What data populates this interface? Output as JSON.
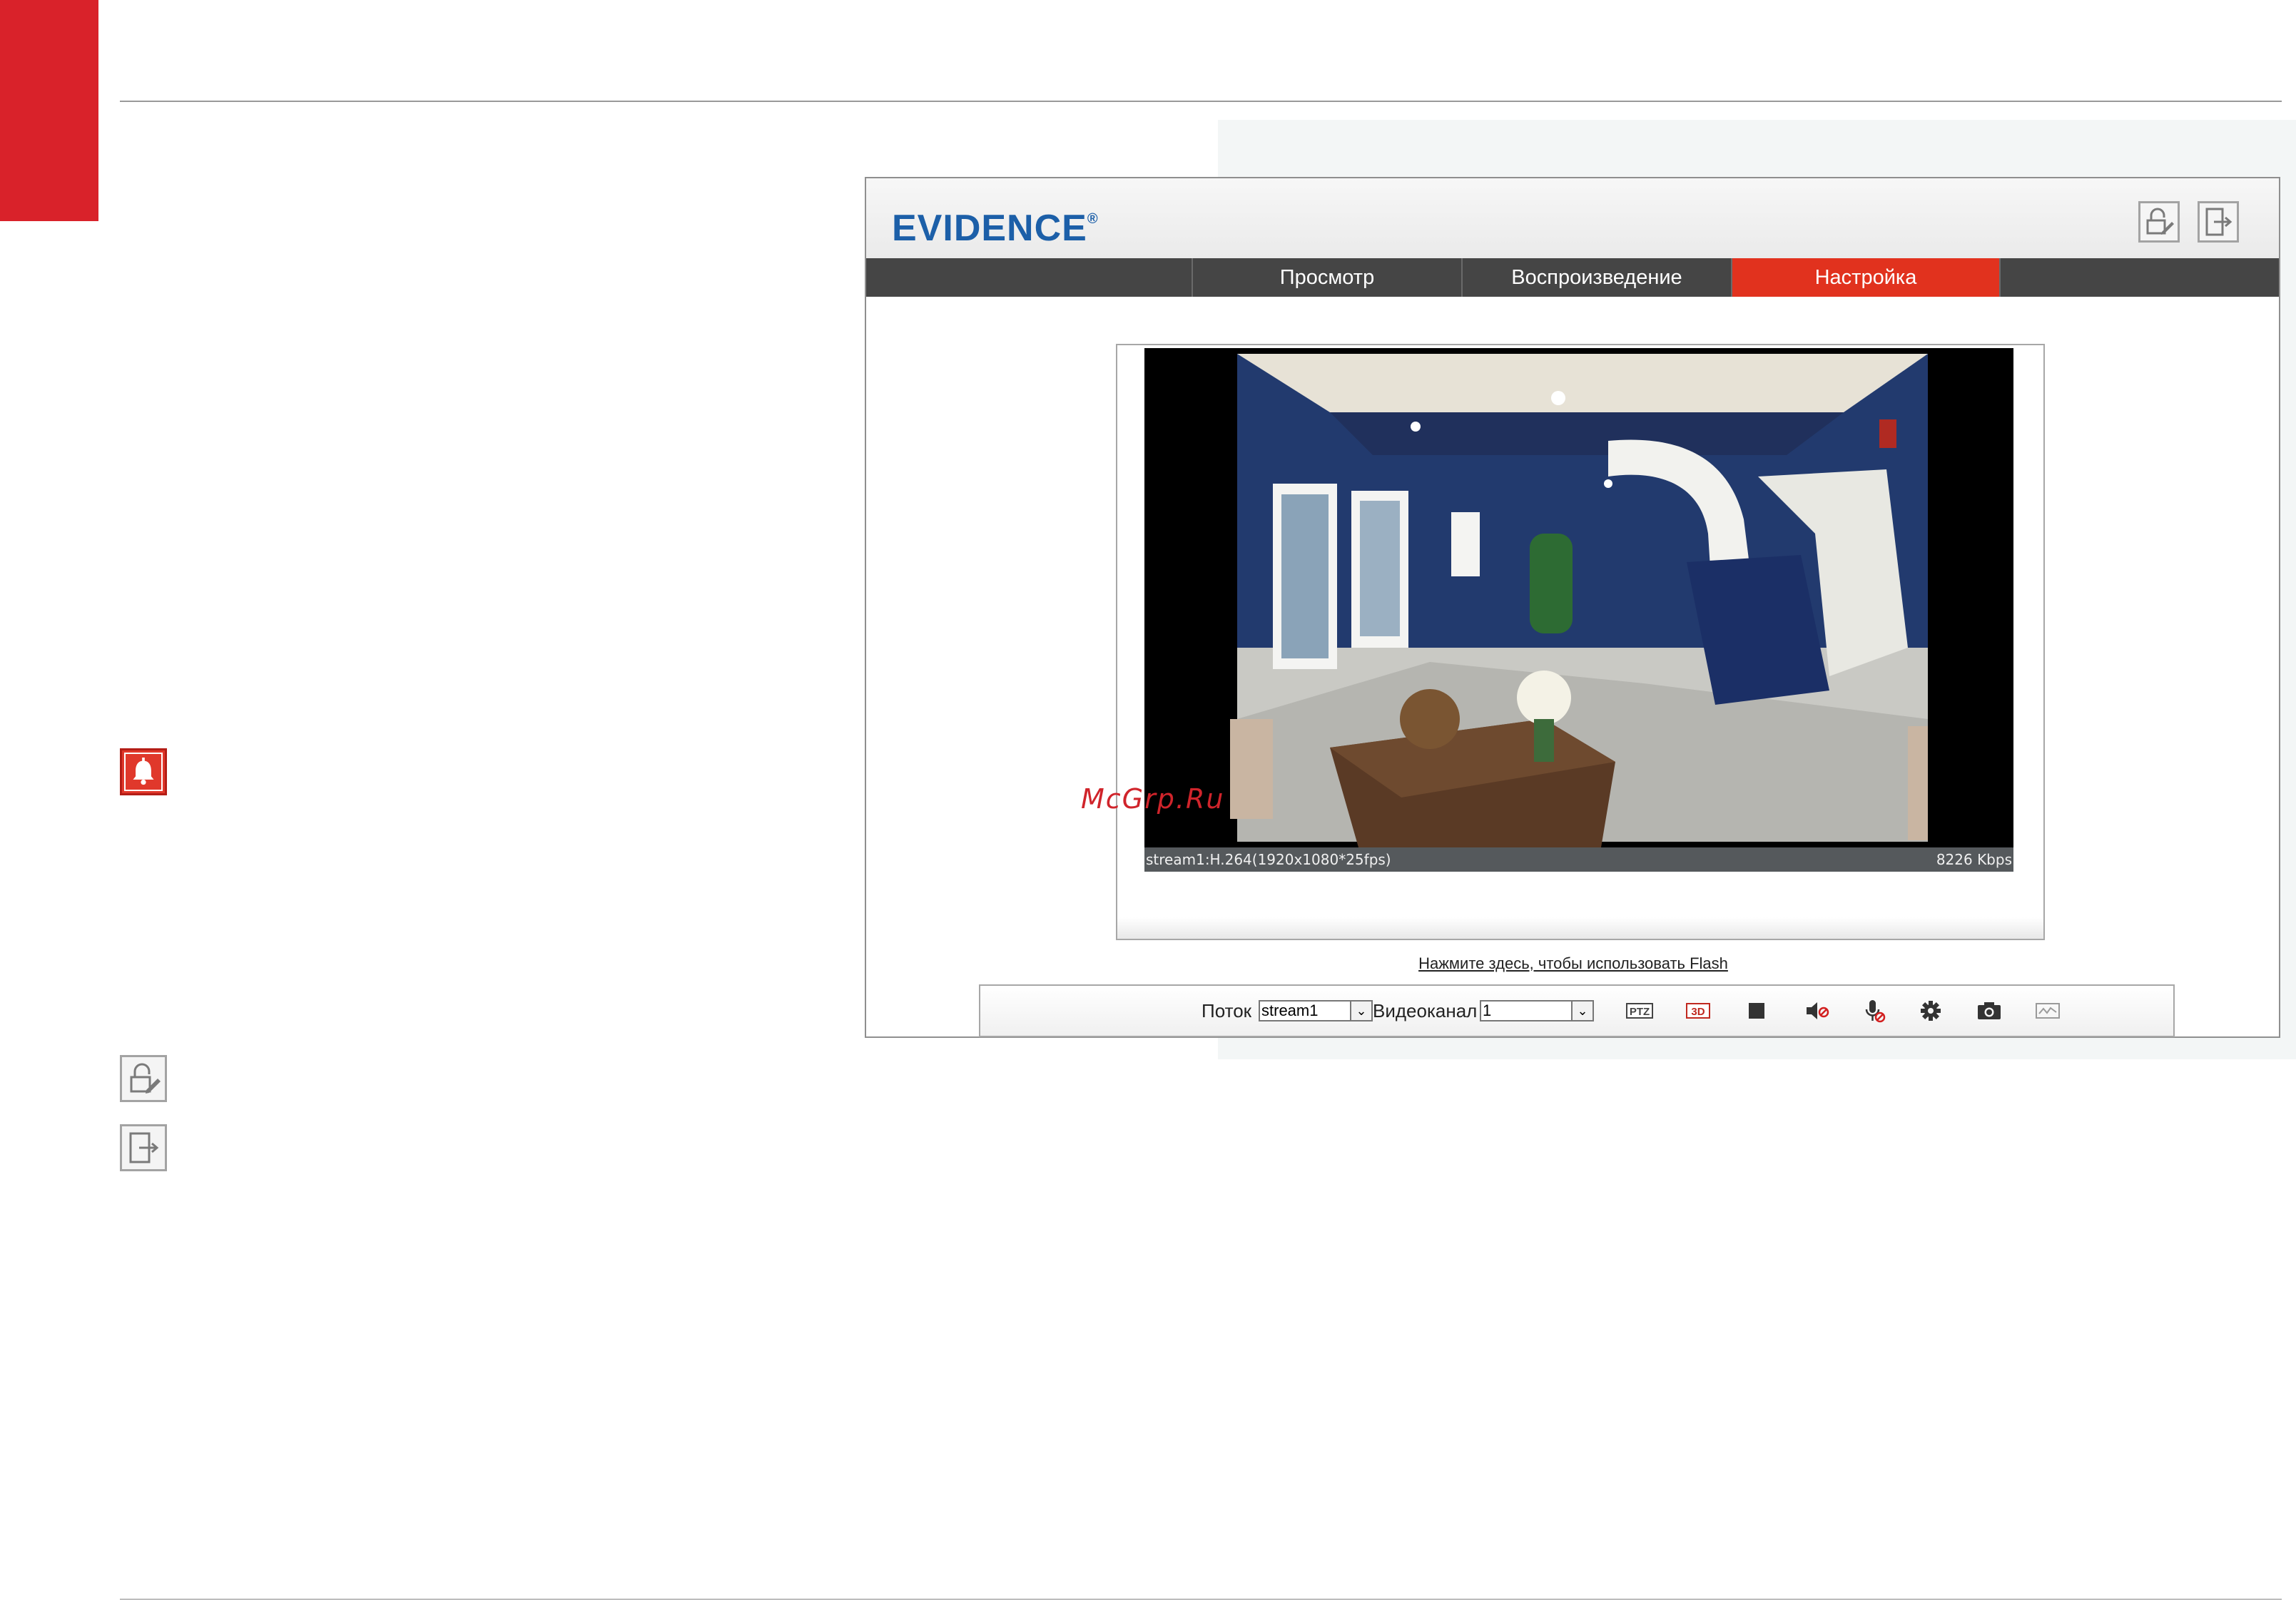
{
  "app": {
    "logo_text": "EVIDENCE",
    "logo_mark": "®",
    "brand_color": "#1c5fa8",
    "accent_color": "#e1321e"
  },
  "nav": {
    "tabs": [
      {
        "label": "Просмотр",
        "active": false
      },
      {
        "label": "Воспроизведение",
        "active": false
      },
      {
        "label": "Настройка",
        "active": true
      }
    ]
  },
  "header_icons": [
    "lock-edit-icon",
    "logout-icon"
  ],
  "side_icons": [
    "alarm-bell-icon",
    "lock-edit-icon",
    "logout-icon"
  ],
  "video": {
    "status_left": "stream1:H.264(1920x1080*25fps)",
    "status_right": "8226 Kbps"
  },
  "watermark": "McGrp.Ru",
  "flash_link": "Нажмите здесь, чтобы использовать Flash",
  "toolbar": {
    "stream_label": "Поток",
    "stream_value": "stream1",
    "channel_label": "Видеоканал",
    "channel_value": "1",
    "icons": [
      "ptz-icon",
      "3d-zoom-icon",
      "stop-icon",
      "audio-muted-icon",
      "microphone-off-icon",
      "settings-gear-icon",
      "snapshot-camera-icon",
      "image-adjust-icon"
    ],
    "ptz_text": "PTZ",
    "zoom3d_text": "3D"
  }
}
